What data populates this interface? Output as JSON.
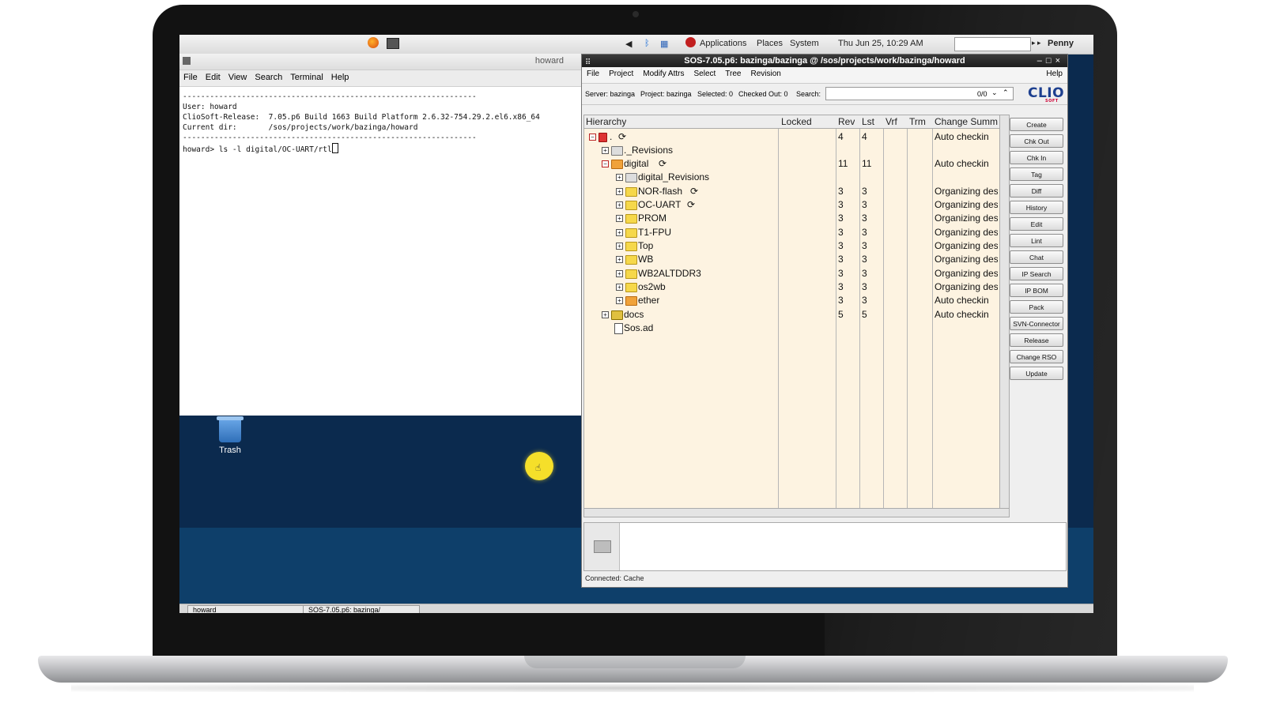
{
  "topbar": {
    "applications": "Applications",
    "places": "Places",
    "system": "System",
    "datetime": "Thu Jun 25, 10:29 AM",
    "user": "Penny"
  },
  "terminal": {
    "title": "howard",
    "menu": [
      "File",
      "Edit",
      "View",
      "Search",
      "Terminal",
      "Help"
    ],
    "lines": [
      "-----------------------------------------------------------------",
      "User: howard",
      "ClioSoft-Release:  7.05.p6 Build 1663 Build Platform 2.6.32-754.29.2.el6.x86_64",
      "Current dir:       /sos/projects/work/bazinga/howard",
      "-----------------------------------------------------------------",
      "",
      "howard> ls -l digital/OC-UART/rtl"
    ]
  },
  "desktop": {
    "trash_label": "Trash"
  },
  "sos": {
    "title": "SOS-7.05.p6: bazinga/bazinga @ /sos/projects/work/bazinga/howard",
    "menu": [
      "File",
      "Project",
      "Modify Attrs",
      "Select",
      "Tree",
      "Revision"
    ],
    "help": "Help",
    "info": {
      "server": "Server: bazinga",
      "project": "Project: bazinga",
      "selected": "Selected: 0",
      "checked_out": "Checked Out: 0",
      "search_label": "Search:",
      "search_count": "0/0"
    },
    "logo": "CLIO",
    "logo_sub": "SOFT",
    "columns": [
      "Hierarchy",
      "Locked",
      "Rev",
      "Lst",
      "Vrf",
      "Trm",
      "Change Summary"
    ],
    "rows": [
      {
        "name": ".",
        "rev": "4",
        "lst": "4",
        "summary": "Auto checkin"
      },
      {
        "name": "._Revisions",
        "rev": "",
        "lst": "",
        "summary": ""
      },
      {
        "name": "digital",
        "rev": "11",
        "lst": "11",
        "summary": "Auto checkin"
      },
      {
        "name": "digital_Revisions",
        "rev": "",
        "lst": "",
        "summary": ""
      },
      {
        "name": "NOR-flash",
        "rev": "3",
        "lst": "3",
        "summary": "Organizing design"
      },
      {
        "name": "OC-UART",
        "rev": "3",
        "lst": "3",
        "summary": "Organizing design"
      },
      {
        "name": "PROM",
        "rev": "3",
        "lst": "3",
        "summary": "Organizing design"
      },
      {
        "name": "T1-FPU",
        "rev": "3",
        "lst": "3",
        "summary": "Organizing design"
      },
      {
        "name": "Top",
        "rev": "3",
        "lst": "3",
        "summary": "Organizing design"
      },
      {
        "name": "WB",
        "rev": "3",
        "lst": "3",
        "summary": "Organizing design"
      },
      {
        "name": "WB2ALTDDR3",
        "rev": "3",
        "lst": "3",
        "summary": "Organizing design"
      },
      {
        "name": "os2wb",
        "rev": "3",
        "lst": "3",
        "summary": "Organizing design"
      },
      {
        "name": "ether",
        "rev": "3",
        "lst": "3",
        "summary": "Auto checkin"
      },
      {
        "name": "docs",
        "rev": "5",
        "lst": "5",
        "summary": "Auto checkin"
      },
      {
        "name": "Sos.ad",
        "rev": "",
        "lst": "",
        "summary": ""
      }
    ],
    "buttons": [
      "Create",
      "Chk Out",
      "Chk In",
      "Tag",
      "Diff",
      "History",
      "Edit",
      "Lint",
      "Chat",
      "IP Search",
      "IP BOM",
      "Pack",
      "SVN-Connector",
      "Release",
      "Change RSO",
      "Update"
    ],
    "status": "Connected: Cache"
  },
  "taskbar": {
    "items": [
      "howard",
      "SOS-7.05.p6: bazinga/"
    ]
  }
}
